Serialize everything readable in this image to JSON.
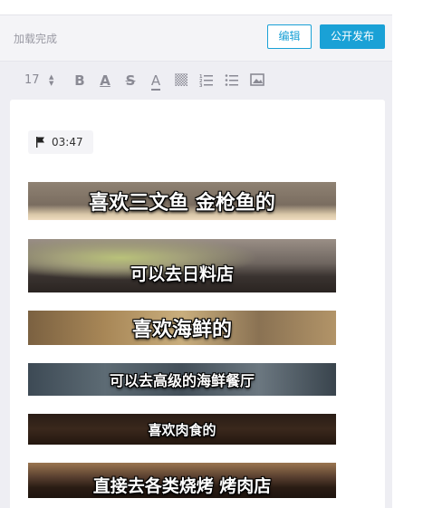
{
  "status": {
    "text": "加载完成"
  },
  "actions": {
    "edit_label": "编辑",
    "publish_label": "公开发布"
  },
  "toolbar": {
    "font_size": "17",
    "bold": "B",
    "font_color": "A",
    "strikethrough": "S",
    "highlight": "A"
  },
  "note": {
    "timestamp": "03:47",
    "captions": [
      "喜欢三文鱼 金枪鱼的",
      "可以去日料店",
      "喜欢海鲜的",
      "可以去高级的海鲜餐厅",
      "喜欢肉食的",
      "直接去各类烧烤 烤肉店"
    ]
  },
  "colors": {
    "accent": "#1aa1d6",
    "background": "#eeeef3"
  }
}
